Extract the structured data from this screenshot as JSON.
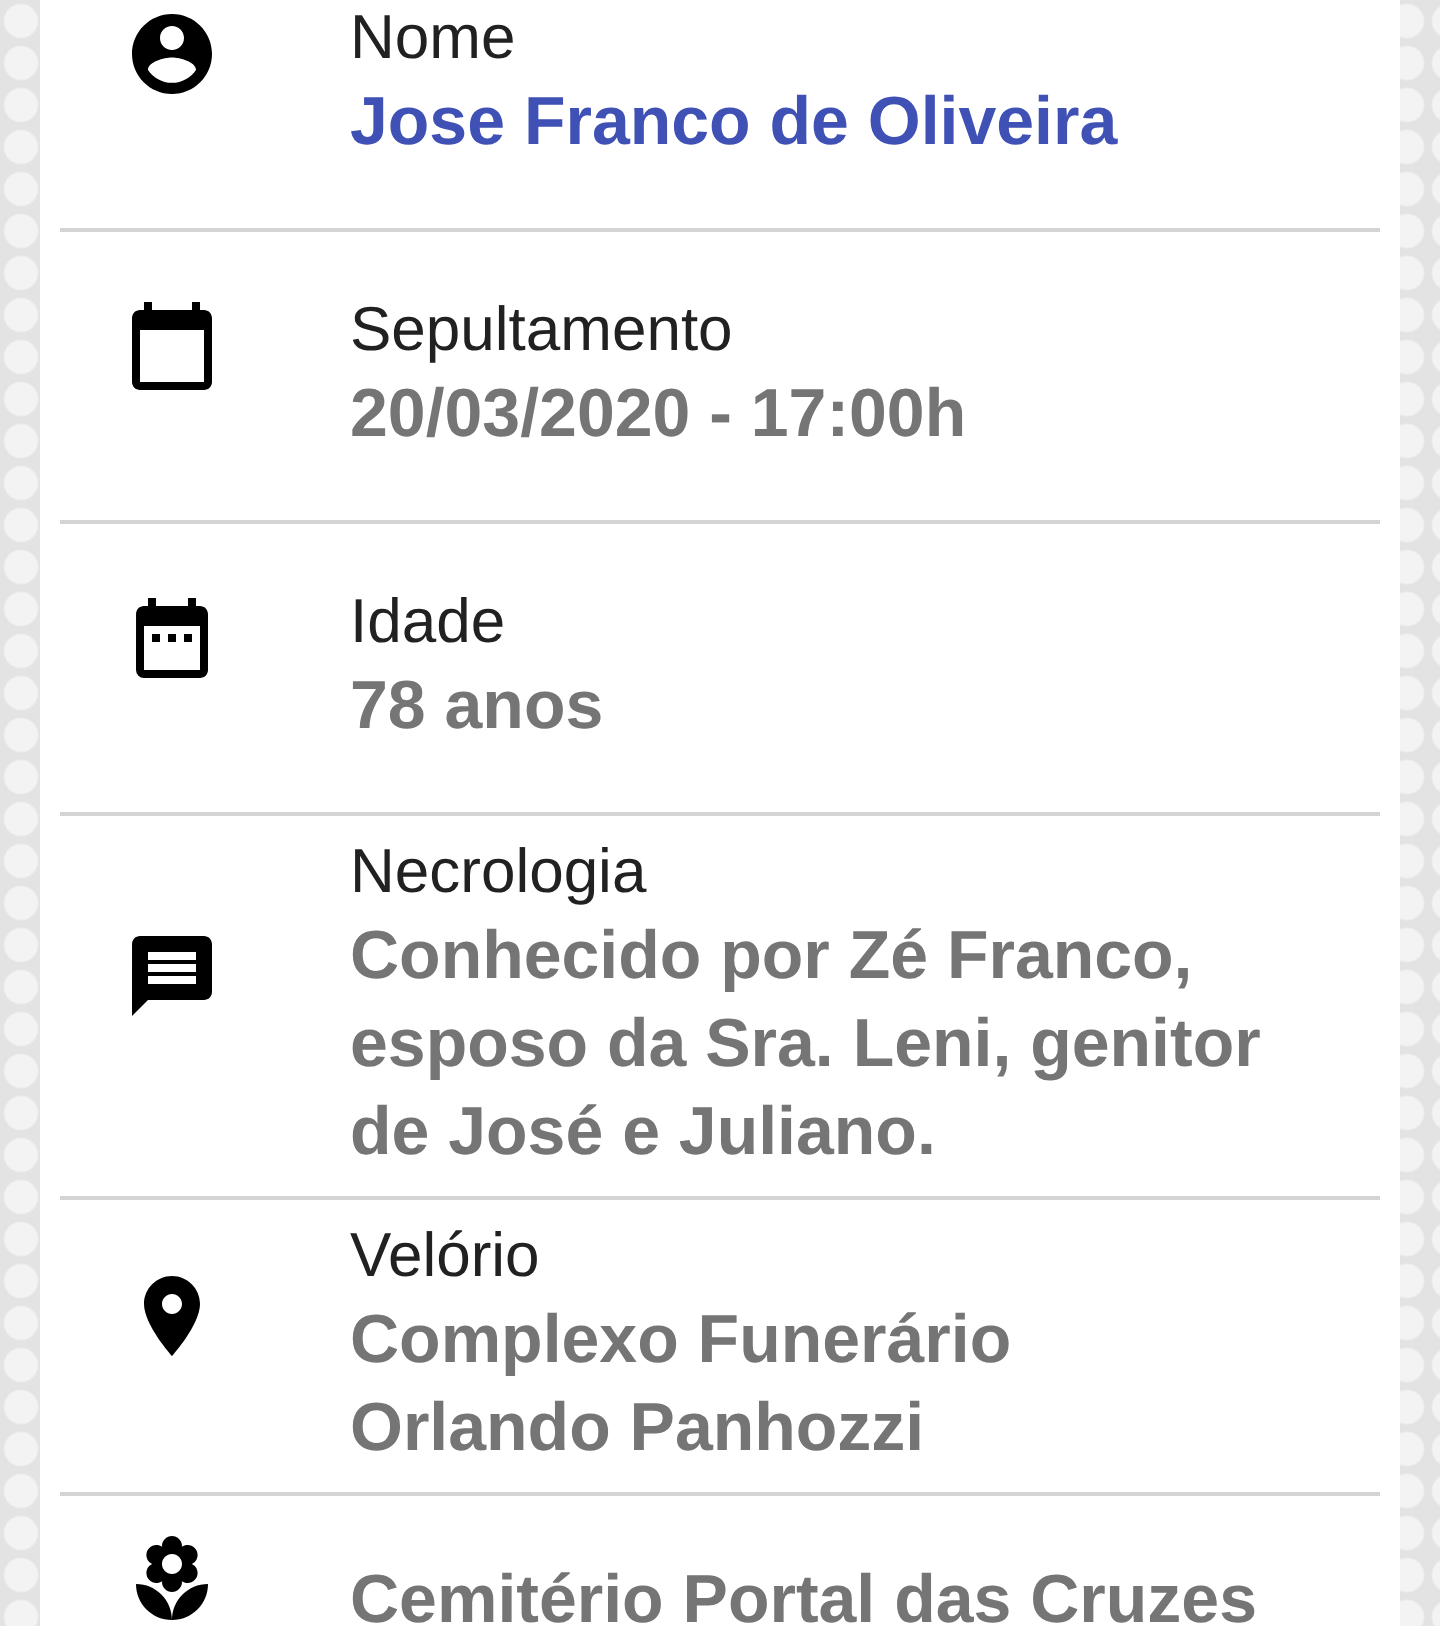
{
  "fields": [
    {
      "kind": "name",
      "label": "Nome",
      "value": "Jose Franco de Oliveira"
    },
    {
      "kind": "burial",
      "label": "Sepultamento",
      "value": "20/03/2020 - 17:00h"
    },
    {
      "kind": "age",
      "label": "Idade",
      "value": "78 anos"
    },
    {
      "kind": "obituary",
      "label": "Necrologia",
      "value": "Conhecido por Zé Franco, esposo da Sra. Leni, genitor de José e Juliano."
    },
    {
      "kind": "wake",
      "label": "Velório",
      "value": "Complexo Funerário Orlando Panhozzi"
    },
    {
      "kind": "cemetery",
      "value": "Cemitério Portal das Cruzes"
    }
  ]
}
